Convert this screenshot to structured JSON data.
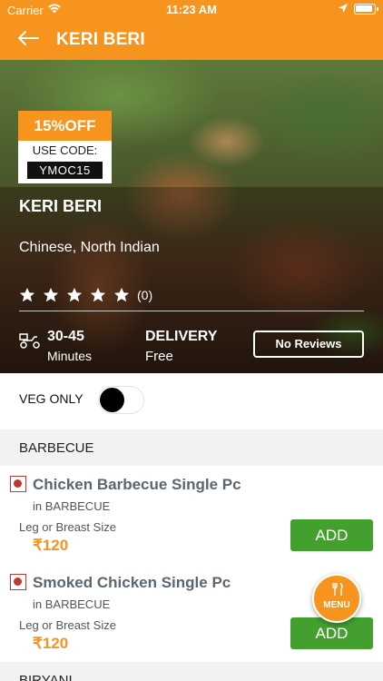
{
  "status_bar": {
    "carrier": "Carrier",
    "time": "11:23 AM",
    "icons": [
      "wifi-icon",
      "location-arrow-icon",
      "battery-icon"
    ]
  },
  "header": {
    "title": "KERI BERI",
    "back_icon": "back-arrow-icon",
    "background_color": "#f7941d"
  },
  "offer": {
    "discount": "15%OFF",
    "use_code_label": "USE CODE:",
    "code": "YMOC15"
  },
  "restaurant": {
    "name": "KERI BERI",
    "cuisine": "Chinese, North Indian",
    "rating_stars": 5,
    "rating_count": "(0)",
    "delivery_time": "30-45",
    "delivery_time_unit": "Minutes",
    "delivery_label": "DELIVERY",
    "delivery_value": "Free",
    "reviews_button": "No Reviews"
  },
  "filters": {
    "veg_only_label": "VEG ONLY",
    "veg_only_on": false
  },
  "menu": {
    "categories": [
      {
        "name": "BARBECUE",
        "items": [
          {
            "name": "Chicken Barbecue Single Pc",
            "category": "in BARBECUE",
            "description": "Leg or Breast Size",
            "price": "₹120",
            "add_label": "ADD",
            "type_icon": "non-veg-icon"
          },
          {
            "name": "Smoked Chicken Single Pc",
            "category": "in BARBECUE",
            "description": "Leg or Breast Size",
            "price": "₹120",
            "add_label": "ADD",
            "type_icon": "non-veg-icon"
          }
        ]
      },
      {
        "name": "BIRYANI",
        "items": []
      }
    ]
  },
  "menu_button": {
    "label": "MENU",
    "icon": "fork-knife-icon"
  },
  "colors": {
    "accent": "#f7941d",
    "add_button": "#43a02f",
    "non_veg": "#c0392b",
    "item_name": "#5a6670"
  }
}
